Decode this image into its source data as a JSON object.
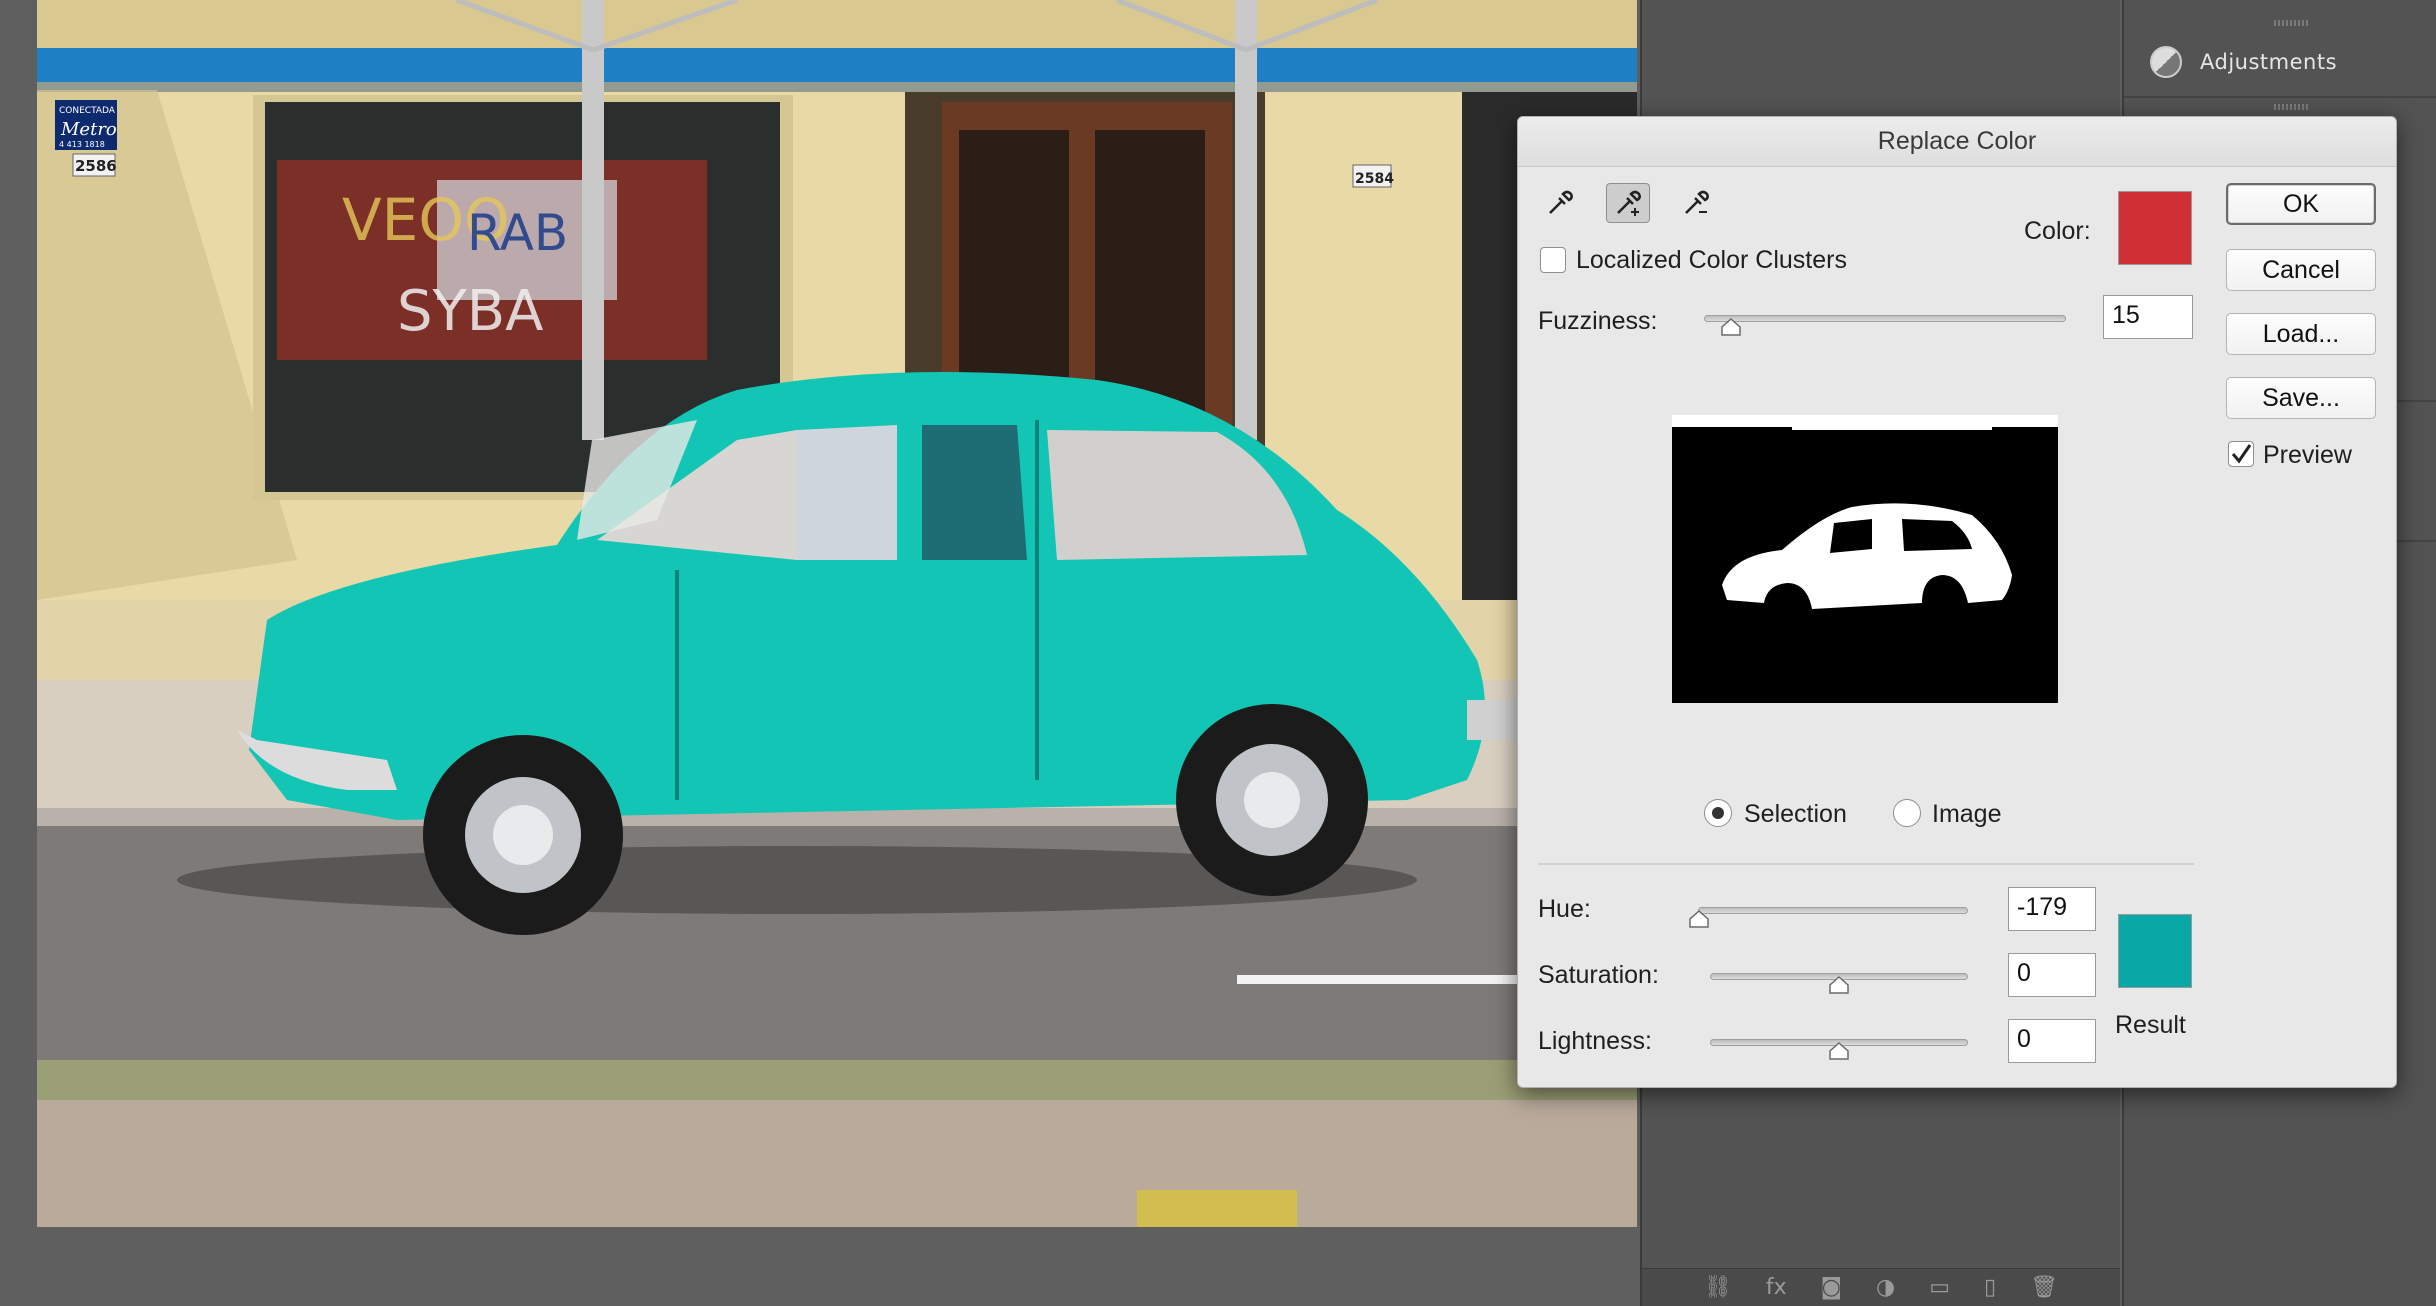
{
  "photo": {
    "sign_text": [
      "CONECTADA",
      "Metro",
      "4 413 1818",
      "2586"
    ],
    "door_number": "2584",
    "window_text": [
      "RAB",
      "VEOO",
      "SYBA"
    ]
  },
  "dialog": {
    "title": "Replace Color",
    "eyedroppers": [
      "eyedropper-icon",
      "eyedropper-plus-icon",
      "eyedropper-minus-icon"
    ],
    "localized_label": "Localized Color Clusters",
    "localized_checked": false,
    "color_label": "Color:",
    "color_swatch": "#cf2f35",
    "fuzziness_label": "Fuzziness:",
    "fuzziness_value": "15",
    "fuzziness_level": 0.075,
    "view_options": [
      {
        "label": "Selection",
        "selected": true
      },
      {
        "label": "Image",
        "selected": false
      }
    ],
    "hue_label": "Hue:",
    "hue_value": "-179",
    "hue_level": 0.003,
    "saturation_label": "Saturation:",
    "saturation_value": "0",
    "saturation_level": 0.5,
    "lightness_label": "Lightness:",
    "lightness_value": "0",
    "lightness_level": 0.5,
    "result_label": "Result",
    "result_swatch": "#08a8a6",
    "buttons": {
      "ok": "OK",
      "cancel": "Cancel",
      "load": "Load...",
      "save": "Save..."
    },
    "preview_label": "Preview",
    "preview_checked": true
  },
  "panels": {
    "adjustments_label": "Adjustments",
    "footer_icons": [
      "link-icon",
      "fx-icon",
      "mask-icon",
      "adjustment-icon",
      "folder-icon",
      "new-layer-icon",
      "trash-icon"
    ]
  }
}
